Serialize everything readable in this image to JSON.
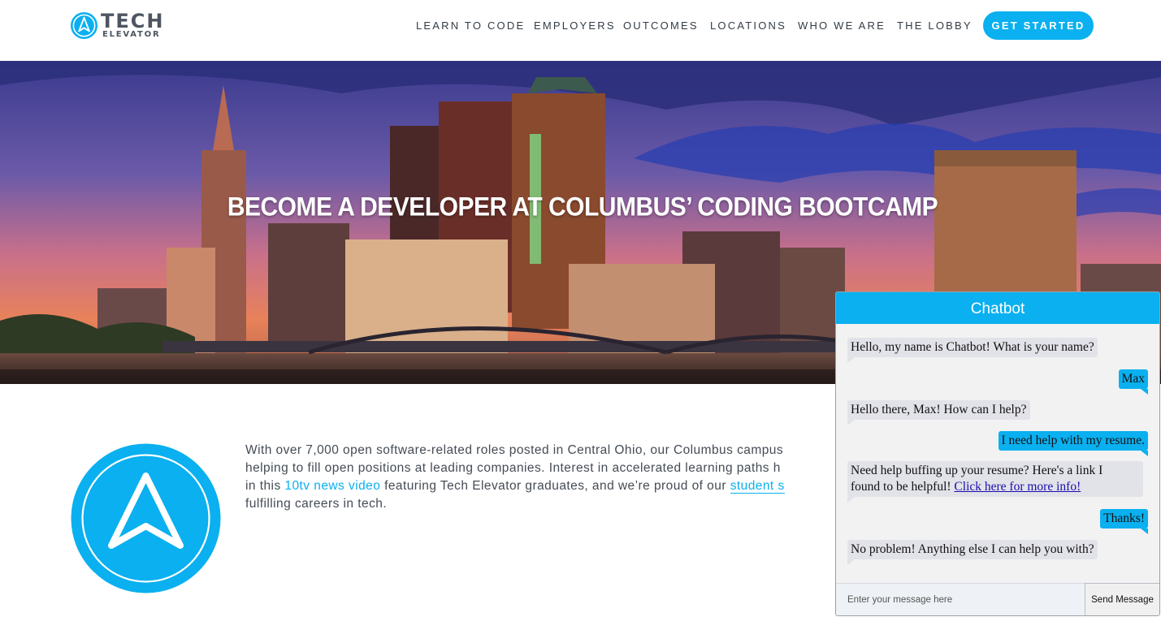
{
  "brand": {
    "name_line1": "TECH",
    "name_line2": "ELEVATOR",
    "accent": "#0ab0ef",
    "text_color": "#4d5560"
  },
  "nav": {
    "items": [
      {
        "label": "LEARN TO CODE"
      },
      {
        "label": "EMPLOYERS"
      },
      {
        "label": "OUTCOMES"
      },
      {
        "label": "LOCATIONS"
      },
      {
        "label": "WHO WE ARE"
      },
      {
        "label": "THE LOBBY"
      }
    ],
    "cta_label": "GET STARTED"
  },
  "hero": {
    "title": "BECOME A DEVELOPER AT COLUMBUS’ CODING BOOTCAMP"
  },
  "content": {
    "line1": "With over 7,000 open software-related roles posted in Central Ohio, our Columbus campus",
    "line2": "helping to fill open positions at leading companies. Interest in accelerated learning paths h",
    "line3_pre": "in this ",
    "line3_link": "10tv news video",
    "line3_mid": " featuring Tech Elevator graduates, and we’re proud of our ",
    "line3_link2": "student s",
    "line4": "fulfilling careers in tech."
  },
  "chatbot": {
    "title": "Chatbot",
    "messages": [
      {
        "from": "bot",
        "text": "Hello, my name is Chatbot! What is your name?"
      },
      {
        "from": "user",
        "text": "Max"
      },
      {
        "from": "bot",
        "text": "Hello there, Max! How can I help?"
      },
      {
        "from": "user",
        "text": "I need help with my resume."
      },
      {
        "from": "bot",
        "text_line1": "Need help buffing up your resume? Here's a link I",
        "text_line2_pre": "found to be helpful! ",
        "link": "Click here for more info!"
      },
      {
        "from": "user",
        "text": "Thanks!"
      },
      {
        "from": "bot",
        "text": "No problem! Anything else I can help you with?"
      }
    ],
    "input_placeholder": "Enter your message here",
    "send_label": "Send Message",
    "header_color": "#0ab0ef"
  }
}
